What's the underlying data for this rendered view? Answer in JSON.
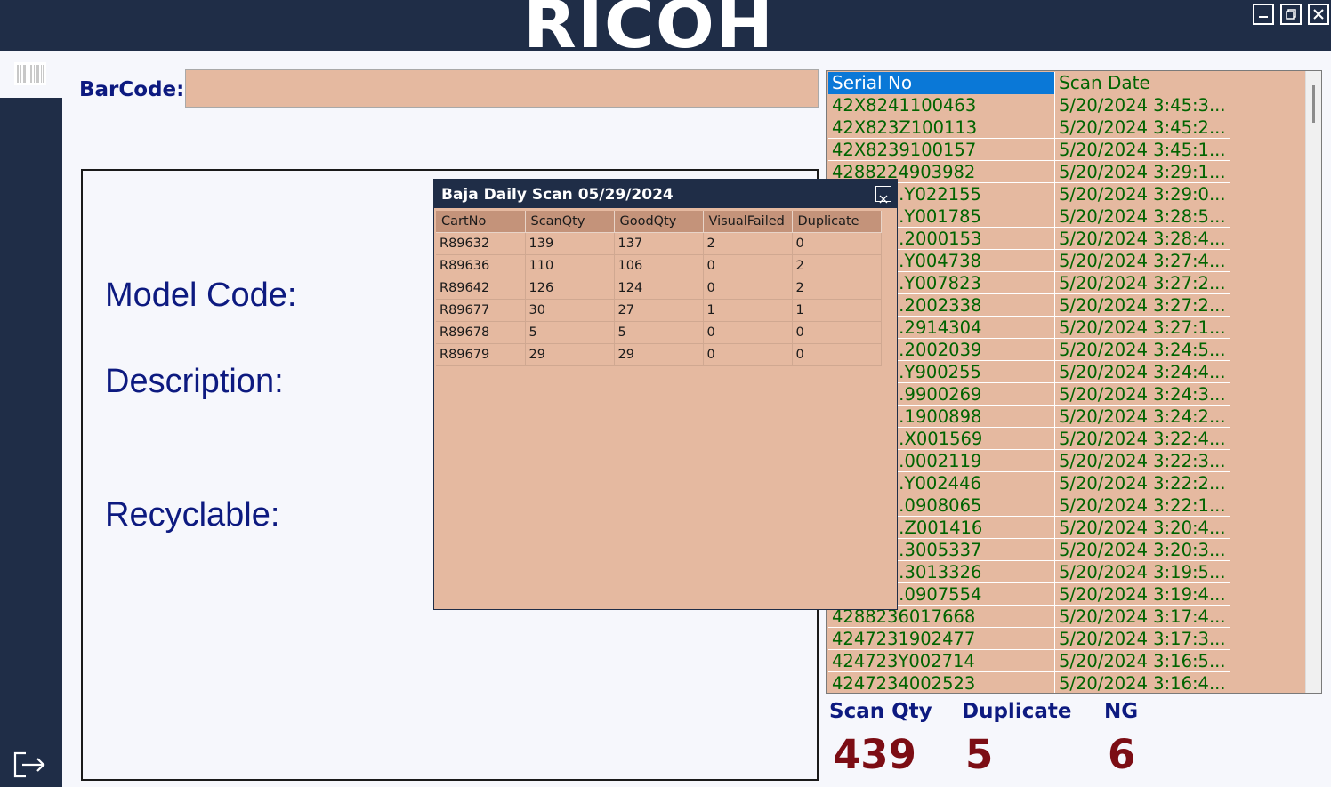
{
  "header": {
    "logo_text": "RICOH",
    "window_controls": [
      "minimize-icon",
      "restore-icon",
      "close-icon"
    ]
  },
  "sidebar": {
    "icons": [
      "barcode-icon",
      "exit-icon"
    ]
  },
  "barcode": {
    "label": "BarCode:",
    "value": ""
  },
  "details": {
    "model_code_label": "Model Code:",
    "description_label": "Description:",
    "recyclable_label": "Recyclable:"
  },
  "scan_grid": {
    "columns": [
      "Serial No",
      "Scan Date"
    ],
    "rows": [
      [
        "42X8241100463",
        "5/20/2024 3:45:3..."
      ],
      [
        "42X823Z100113",
        "5/20/2024 3:45:2..."
      ],
      [
        "42X8239100157",
        "5/20/2024 3:45:1..."
      ],
      [
        "4288224903982",
        "5/20/2024 3:29:1..."
      ],
      [
        "42882…Y022155",
        "5/20/2024 3:29:0..."
      ],
      [
        "42882…Y001785",
        "5/20/2024 3:28:5..."
      ],
      [
        "42882…2000153",
        "5/20/2024 3:28:4..."
      ],
      [
        "42882…Y004738",
        "5/20/2024 3:27:4..."
      ],
      [
        "42882…Y007823",
        "5/20/2024 3:27:2..."
      ],
      [
        "42882…2002338",
        "5/20/2024 3:27:2..."
      ],
      [
        "42882…2914304",
        "5/20/2024 3:27:1..."
      ],
      [
        "42882…2002039",
        "5/20/2024 3:24:5..."
      ],
      [
        "42882…Y900255",
        "5/20/2024 3:24:4..."
      ],
      [
        "42882…9900269",
        "5/20/2024 3:24:3..."
      ],
      [
        "42882…1900898",
        "5/20/2024 3:24:2..."
      ],
      [
        "42882…X001569",
        "5/20/2024 3:22:4..."
      ],
      [
        "42882…0002119",
        "5/20/2024 3:22:3..."
      ],
      [
        "42882…Y002446",
        "5/20/2024 3:22:2..."
      ],
      [
        "42882…0908065",
        "5/20/2024 3:22:1..."
      ],
      [
        "42882…Z001416",
        "5/20/2024 3:20:4..."
      ],
      [
        "42882…3005337",
        "5/20/2024 3:20:3..."
      ],
      [
        "42882…3013326",
        "5/20/2024 3:19:5..."
      ],
      [
        "42882…0907554",
        "5/20/2024 3:19:4..."
      ],
      [
        "4288236017668",
        "5/20/2024 3:17:4..."
      ],
      [
        "4247231902477",
        "5/20/2024 3:17:3..."
      ],
      [
        "424723Y002714",
        "5/20/2024 3:16:5..."
      ],
      [
        "4247234002523",
        "5/20/2024 3:16:4..."
      ]
    ]
  },
  "stats": {
    "scan_qty_label": "Scan Qty",
    "scan_qty_value": "439",
    "duplicate_label": "Duplicate",
    "duplicate_value": "5",
    "ng_label": "NG",
    "ng_value": "6"
  },
  "popup": {
    "title": "Baja Daily Scan 05/29/2024",
    "columns": [
      "CartNo",
      "ScanQty",
      "GoodQty",
      "VisualFailed",
      "Duplicate"
    ],
    "rows": [
      [
        "R89632",
        "139",
        "137",
        "2",
        "0"
      ],
      [
        "R89636",
        "110",
        "106",
        "0",
        "2"
      ],
      [
        "R89642",
        "126",
        "124",
        "0",
        "2"
      ],
      [
        "R89677",
        "30",
        "27",
        "1",
        "1"
      ],
      [
        "R89678",
        "5",
        "5",
        "0",
        "0"
      ],
      [
        "R89679",
        "29",
        "29",
        "0",
        "0"
      ]
    ]
  }
}
